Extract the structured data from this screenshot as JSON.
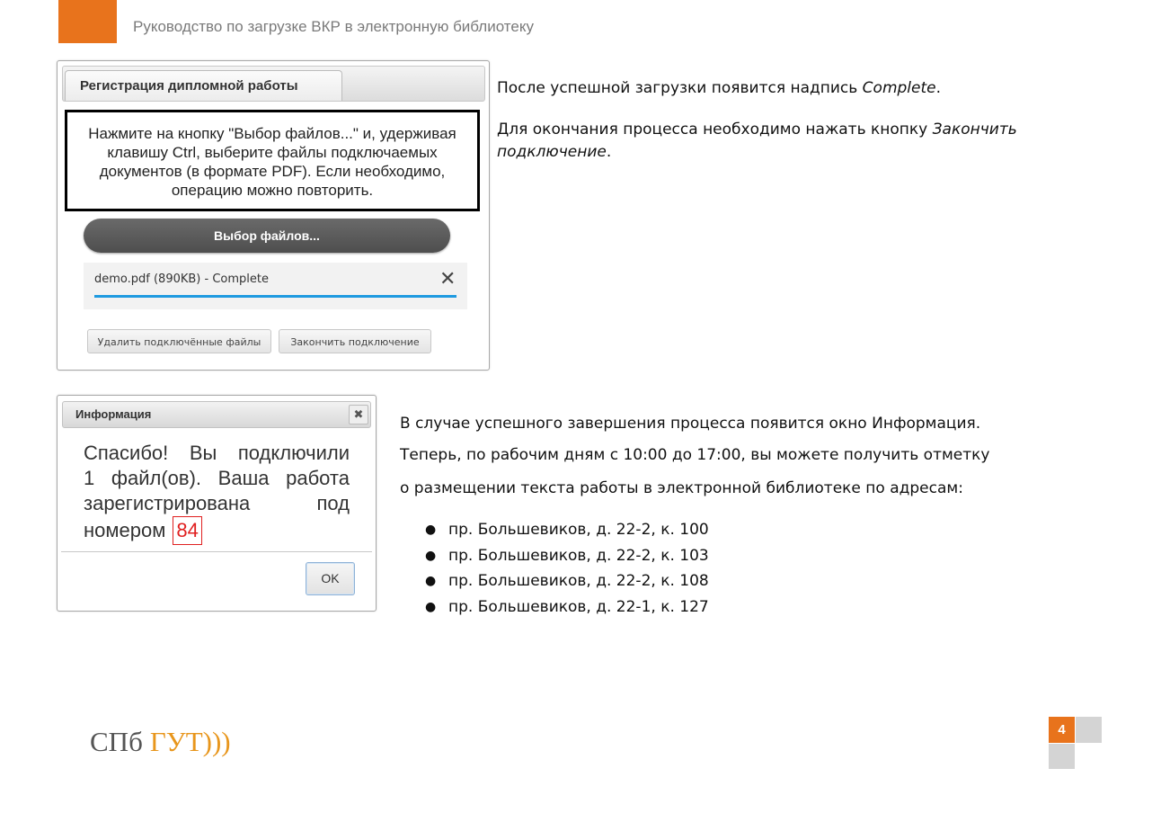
{
  "header": {
    "title": "Руководство по загрузке ВКР в электронную библиотеку",
    "accent_color": "#e8731c"
  },
  "registration": {
    "tab_label": "Регистрация дипломной работы",
    "instructions": "Нажмите на кнопку \"Выбор файлов...\" и, удерживая клавишу Ctrl, выберите файлы подключаемых документов (в формате PDF). Если необходимо, операцию можно повторить.",
    "choose_button": "Выбор файлов...",
    "file": {
      "name": "demo.pdf (890KB) - Complete",
      "progress": 1.0,
      "remove_icon": "close-icon"
    },
    "delete_button": "Удалить подключённые файлы",
    "finish_button": "Закончить подключение"
  },
  "notes": {
    "p1_prefix": "После успешной загрузки появится надпись ",
    "p1_em": "Complete",
    "p1_suffix": ".",
    "p2_prefix": "Для окончания процесса необходимо нажать кнопку ",
    "p2_em": "Закончить подключение",
    "p2_suffix": "."
  },
  "info_dialog": {
    "title": "Информация",
    "close_icon": "close-icon",
    "line1": "Спасибо! Вы подключили",
    "line2": "1 файл(ов). Ваша работа",
    "line3": "зарегистрирована под",
    "line4_prefix": "номером",
    "number": "84",
    "ok_button": "OK"
  },
  "completion": {
    "line1": "В случае успешного завершения процесса появится окно Информация.",
    "line2": "Теперь, по рабочим дням с 10:00 до 17:00, вы можете получить отметку",
    "line3": "о размещении текста работы в электронной библиотеке по адресам:",
    "addresses": [
      "пр. Большевиков, д. 22-2, к. 100",
      "пр. Большевиков, д. 22-2, к. 103",
      "пр. Большевиков, д. 22-2, к. 108",
      "пр. Большевиков, д. 22-1, к. 127"
    ]
  },
  "footer": {
    "logo_part1": "СПб",
    "logo_part2": "ГУТ",
    "logo_waves": ")))",
    "page_number": "4"
  }
}
